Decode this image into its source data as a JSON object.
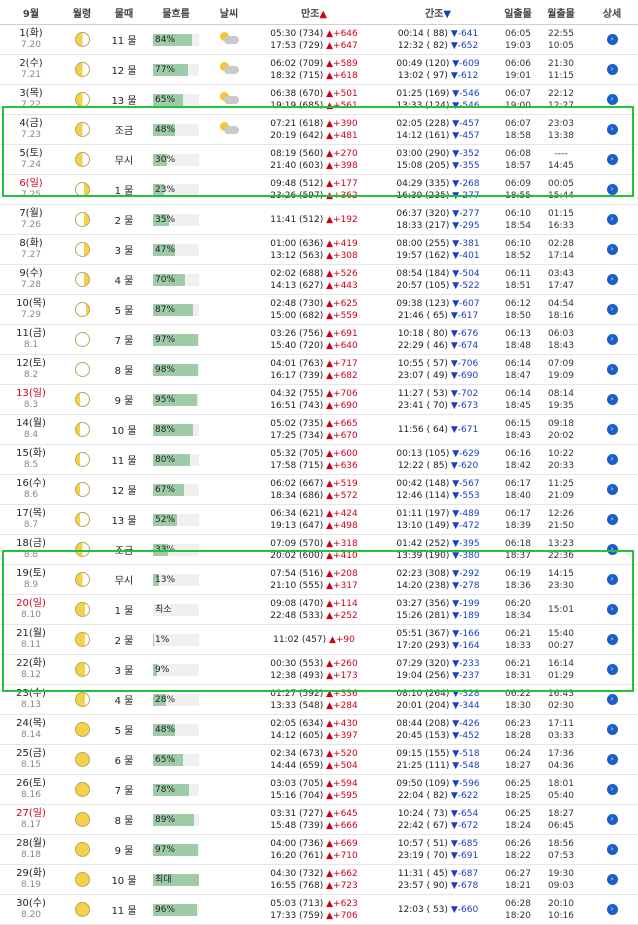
{
  "header": {
    "month": "9월",
    "phase": "월령",
    "mul": "물때",
    "flow": "물흐름",
    "weather": "날씨",
    "high": "만조",
    "low": "간조",
    "sunrise": "일출몰",
    "moonrise": "월출몰",
    "detail": "상세",
    "high_arrow": "▲",
    "low_arrow": "▼"
  },
  "colors": {
    "highlight_border": "#23c23a",
    "bar_fill": "#9fcca8",
    "high_red": "#d0021b",
    "low_blue": "#1a3fbf",
    "detail_blue": "#1a5fc8"
  },
  "rows": [
    {
      "day": "1(화)",
      "lunar": "7.20",
      "phase": "half",
      "mul": "11 물",
      "flow": "84%",
      "flowv": 84,
      "weather": "partly-cloudy-icon",
      "h1": "05:30 (734)",
      "h1d": "▲+646",
      "h2": "17:53 (729)",
      "h2d": "▲+647",
      "l1": "00:14 ( 88)",
      "l1d": "▼-641",
      "l2": "12:32 ( 82)",
      "l2d": "▼-652",
      "sr": "06:05",
      "ss": "19:03",
      "mr": "22:55",
      "ms": "10:05",
      "det": "›"
    },
    {
      "day": "2(수)",
      "lunar": "7.21",
      "phase": "half",
      "mul": "12 물",
      "flow": "77%",
      "flowv": 77,
      "weather": "partly-cloudy-icon",
      "h1": "06:02 (709)",
      "h1d": "▲+589",
      "h2": "18:32 (715)",
      "h2d": "▲+618",
      "l1": "00:49 (120)",
      "l1d": "▼-609",
      "l2": "13:02 ( 97)",
      "l2d": "▼-612",
      "sr": "06:06",
      "ss": "19:01",
      "mr": "21:30",
      "ms": "11:15",
      "det": "›"
    },
    {
      "day": "3(목)",
      "lunar": "7.22",
      "phase": "half",
      "mul": "13 물",
      "flow": "65%",
      "flowv": 65,
      "weather": "partly-cloudy-icon",
      "h1": "06:38 (670)",
      "h1d": "▲+501",
      "h2": "19:19 (685)",
      "h2d": "▲+561",
      "l1": "01:25 (169)",
      "l1d": "▼-546",
      "l2": "13:33 (124)",
      "l2d": "▼-546",
      "sr": "06:07",
      "ss": "19:00",
      "mr": "22:12",
      "ms": "12:27",
      "det": "›"
    },
    {
      "day": "4(금)",
      "lunar": "7.23",
      "phase": "half",
      "mul": "조금",
      "flow": "48%",
      "flowv": 48,
      "weather": "partly-cloudy-icon",
      "h1": "07:21 (618)",
      "h1d": "▲+390",
      "h2": "20:19 (642)",
      "h2d": "▲+481",
      "l1": "02:05 (228)",
      "l1d": "▼-457",
      "l2": "14:12 (161)",
      "l2d": "▼-457",
      "sr": "06:07",
      "ss": "18:58",
      "mr": "23:03",
      "ms": "13:38",
      "det": "›"
    },
    {
      "day": "5(토)",
      "lunar": "7.24",
      "phase": "half",
      "mul": "무시",
      "flow": "30%",
      "flowv": 30,
      "weather": "",
      "h1": "08:19 (560)",
      "h1d": "▲+270",
      "h2": "21:40 (603)",
      "h2d": "▲+398",
      "l1": "03:00 (290)",
      "l1d": "▼-352",
      "l2": "15:08 (205)",
      "l2d": "▼-355",
      "sr": "06:08",
      "ss": "18:57",
      "mr": "----",
      "ms": "14:45",
      "det": "›"
    },
    {
      "day": "6(일)",
      "lunar": "7.25",
      "phase": "crescent",
      "mul": "1 물",
      "flow": "23%",
      "flowv": 23,
      "weather": "",
      "h1": "09:48 (512)",
      "h1d": "▲+177",
      "h2": "23:26 (597)",
      "h2d": "▲+362",
      "l1": "04:29 (335)",
      "l1d": "▼-268",
      "l2": "16:39 (235)",
      "l2d": "▼-277",
      "sr": "06:09",
      "ss": "18:55",
      "mr": "00:05",
      "ms": "15:44",
      "det": "›"
    },
    {
      "day": "7(월)",
      "lunar": "7.26",
      "phase": "crescent",
      "mul": "2 물",
      "flow": "35%",
      "flowv": 35,
      "weather": "",
      "h1": "11:41 (512)",
      "h1d": "▲+192",
      "h2": "",
      "h2d": "",
      "l1": "06:37 (320)",
      "l1d": "▼-277",
      "l2": "18:33 (217)",
      "l2d": "▼-295",
      "sr": "06:10",
      "ss": "18:54",
      "mr": "01:15",
      "ms": "16:33",
      "det": "›"
    },
    {
      "day": "8(화)",
      "lunar": "7.27",
      "phase": "crescent",
      "mul": "3 물",
      "flow": "47%",
      "flowv": 47,
      "weather": "",
      "h1": "01:00 (636)",
      "h1d": "▲+419",
      "h2": "13:12 (563)",
      "h2d": "▲+308",
      "l1": "08:00 (255)",
      "l1d": "▼-381",
      "l2": "19:57 (162)",
      "l2d": "▼-401",
      "sr": "06:10",
      "ss": "18:52",
      "mr": "02:28",
      "ms": "17:14",
      "det": "›"
    },
    {
      "day": "9(수)",
      "lunar": "7.28",
      "phase": "crescent",
      "mul": "4 물",
      "flow": "70%",
      "flowv": 70,
      "weather": "",
      "h1": "02:02 (688)",
      "h1d": "▲+526",
      "h2": "14:13 (627)",
      "h2d": "▲+443",
      "l1": "08:54 (184)",
      "l1d": "▼-504",
      "l2": "20:57 (105)",
      "l2d": "▼-522",
      "sr": "06:11",
      "ss": "18:51",
      "mr": "03:43",
      "ms": "17:47",
      "det": "›"
    },
    {
      "day": "10(목)",
      "lunar": "7.29",
      "phase": "thin",
      "mul": "5 물",
      "flow": "87%",
      "flowv": 87,
      "weather": "",
      "h1": "02:48 (730)",
      "h1d": "▲+625",
      "h2": "15:00 (682)",
      "h2d": "▲+559",
      "l1": "09:38 (123)",
      "l1d": "▼-607",
      "l2": "21:46 ( 65)",
      "l2d": "▼-617",
      "sr": "06:12",
      "ss": "18:50",
      "mr": "04:54",
      "ms": "18:16",
      "det": "›"
    },
    {
      "day": "11(금)",
      "lunar": "8.1",
      "phase": "new",
      "mul": "7 물",
      "flow": "97%",
      "flowv": 97,
      "weather": "",
      "h1": "03:26 (756)",
      "h1d": "▲+691",
      "h2": "15:40 (720)",
      "h2d": "▲+640",
      "l1": "10:18 ( 80)",
      "l1d": "▼-676",
      "l2": "22:29 ( 46)",
      "l2d": "▼-674",
      "sr": "06:13",
      "ss": "18:48",
      "mr": "06:03",
      "ms": "18:43",
      "det": "›"
    },
    {
      "day": "12(토)",
      "lunar": "8.2",
      "phase": "new",
      "mul": "8 물",
      "flow": "98%",
      "flowv": 98,
      "weather": "",
      "h1": "04:01 (763)",
      "h1d": "▲+717",
      "h2": "16:17 (739)",
      "h2d": "▲+682",
      "l1": "10:55 ( 57)",
      "l1d": "▼-706",
      "l2": "23:07 ( 49)",
      "l2d": "▼-690",
      "sr": "06:14",
      "ss": "18:47",
      "mr": "07:09",
      "ms": "19:09",
      "det": "›"
    },
    {
      "day": "13(일)",
      "lunar": "8.3",
      "phase": "waxing",
      "mul": "9 물",
      "flow": "95%",
      "flowv": 95,
      "weather": "",
      "h1": "04:32 (755)",
      "h1d": "▲+706",
      "h2": "16:51 (743)",
      "h2d": "▲+690",
      "l1": "11:27 ( 53)",
      "l1d": "▼-702",
      "l2": "23:41 ( 70)",
      "l2d": "▼-673",
      "sr": "06:14",
      "ss": "18:45",
      "mr": "08:14",
      "ms": "19:35",
      "det": "›"
    },
    {
      "day": "14(월)",
      "lunar": "8.4",
      "phase": "waxing",
      "mul": "10 물",
      "flow": "88%",
      "flowv": 88,
      "weather": "",
      "h1": "05:02 (735)",
      "h1d": "▲+665",
      "h2": "17:25 (734)",
      "h2d": "▲+670",
      "l1": "11:56 ( 64)",
      "l1d": "▼-671",
      "l2": "",
      "l2d": "",
      "sr": "06:15",
      "ss": "18:43",
      "mr": "09:18",
      "ms": "20:02",
      "det": "›"
    },
    {
      "day": "15(화)",
      "lunar": "8.5",
      "phase": "waxing",
      "mul": "11 물",
      "flow": "80%",
      "flowv": 80,
      "weather": "",
      "h1": "05:32 (705)",
      "h1d": "▲+600",
      "h2": "17:58 (715)",
      "h2d": "▲+636",
      "l1": "00:13 (105)",
      "l1d": "▼-629",
      "l2": "12:22 ( 85)",
      "l2d": "▼-620",
      "sr": "06:16",
      "ss": "18:42",
      "mr": "10:22",
      "ms": "20:33",
      "det": "›"
    },
    {
      "day": "16(수)",
      "lunar": "8.6",
      "phase": "waxing",
      "mul": "12 물",
      "flow": "67%",
      "flowv": 67,
      "weather": "",
      "h1": "06:02 (667)",
      "h1d": "▲+519",
      "h2": "18:34 (686)",
      "h2d": "▲+572",
      "l1": "00:42 (148)",
      "l1d": "▼-567",
      "l2": "12:46 (114)",
      "l2d": "▼-553",
      "sr": "06:17",
      "ss": "18:40",
      "mr": "11:25",
      "ms": "21:09",
      "det": "›"
    },
    {
      "day": "17(목)",
      "lunar": "8.7",
      "phase": "waxing",
      "mul": "13 물",
      "flow": "52%",
      "flowv": 52,
      "weather": "",
      "h1": "06:34 (621)",
      "h1d": "▲+424",
      "h2": "19:13 (647)",
      "h2d": "▲+498",
      "l1": "01:11 (197)",
      "l1d": "▼-489",
      "l2": "13:10 (149)",
      "l2d": "▼-472",
      "sr": "06:17",
      "ss": "18:39",
      "mr": "12:26",
      "ms": "21:50",
      "det": "›"
    },
    {
      "day": "18(금)",
      "lunar": "8.8",
      "phase": "half",
      "mul": "조금",
      "flow": "33%",
      "flowv": 33,
      "weather": "",
      "h1": "07:09 (570)",
      "h1d": "▲+318",
      "h2": "20:02 (600)",
      "h2d": "▲+410",
      "l1": "01:42 (252)",
      "l1d": "▼-395",
      "l2": "13:39 (190)",
      "l2d": "▼-380",
      "sr": "06:18",
      "ss": "18:37",
      "mr": "13:23",
      "ms": "22:36",
      "det": "›"
    },
    {
      "day": "19(토)",
      "lunar": "8.9",
      "phase": "half",
      "mul": "무시",
      "flow": "13%",
      "flowv": 13,
      "weather": "",
      "h1": "07:54 (516)",
      "h1d": "▲+208",
      "h2": "21:10 (555)",
      "h2d": "▲+317",
      "l1": "02:23 (308)",
      "l1d": "▼-292",
      "l2": "14:20 (238)",
      "l2d": "▼-278",
      "sr": "06:19",
      "ss": "18:36",
      "mr": "14:15",
      "ms": "23:30",
      "det": "›"
    },
    {
      "day": "20(일)",
      "lunar": "8.10",
      "phase": "gibbous",
      "mul": "1 물",
      "flow": "최소",
      "flowv": 0,
      "weather": "",
      "h1": "09:08 (470)",
      "h1d": "▲+114",
      "h2": "22:48 (533)",
      "h2d": "▲+252",
      "l1": "03:27 (356)",
      "l1d": "▼-199",
      "l2": "15:26 (281)",
      "l2d": "▼-189",
      "sr": "06:20",
      "ss": "18:34",
      "mr": "15:01",
      "ms": "",
      "det": "›"
    },
    {
      "day": "21(월)",
      "lunar": "8.11",
      "phase": "gibbous",
      "mul": "2 물",
      "flow": "1%",
      "flowv": 1,
      "weather": "",
      "h1": "11:02 (457)",
      "h1d": "▲+90",
      "h2": "",
      "h2d": "",
      "l1": "05:51 (367)",
      "l1d": "▼-166",
      "l2": "17:20 (293)",
      "l2d": "▼-164",
      "sr": "06:21",
      "ss": "18:33",
      "mr": "15:40",
      "ms": "00:27",
      "det": "›"
    },
    {
      "day": "22(화)",
      "lunar": "8.12",
      "phase": "gibbous",
      "mul": "3 물",
      "flow": "9%",
      "flowv": 9,
      "weather": "",
      "h1": "00:30 (553)",
      "h1d": "▲+260",
      "h2": "12:38 (493)",
      "h2d": "▲+173",
      "l1": "07:29 (320)",
      "l1d": "▼-233",
      "l2": "19:04 (256)",
      "l2d": "▼-237",
      "sr": "06:21",
      "ss": "18:31",
      "mr": "16:14",
      "ms": "01:29",
      "det": "›"
    },
    {
      "day": "23(수)",
      "lunar": "8.13",
      "phase": "gibbous",
      "mul": "4 물",
      "flow": "28%",
      "flowv": 28,
      "weather": "",
      "h1": "01:27 (592)",
      "h1d": "▲+336",
      "h2": "13:33 (548)",
      "h2d": "▲+284",
      "l1": "08:10 (264)",
      "l1d": "▼-328",
      "l2": "20:01 (204)",
      "l2d": "▼-344",
      "sr": "06:22",
      "ss": "18:30",
      "mr": "16:43",
      "ms": "02:30",
      "det": "›"
    },
    {
      "day": "24(목)",
      "lunar": "8.14",
      "phase": "full",
      "mul": "5 물",
      "flow": "48%",
      "flowv": 48,
      "weather": "",
      "h1": "02:05 (634)",
      "h1d": "▲+430",
      "h2": "14:12 (605)",
      "h2d": "▲+397",
      "l1": "08:44 (208)",
      "l1d": "▼-426",
      "l2": "20:45 (153)",
      "l2d": "▼-452",
      "sr": "06:23",
      "ss": "18:28",
      "mr": "17:11",
      "ms": "03:33",
      "det": "›"
    },
    {
      "day": "25(금)",
      "lunar": "8.15",
      "phase": "full",
      "mul": "6 물",
      "flow": "65%",
      "flowv": 65,
      "weather": "",
      "h1": "02:34 (673)",
      "h1d": "▲+520",
      "h2": "14:44 (659)",
      "h2d": "▲+504",
      "l1": "09:15 (155)",
      "l1d": "▼-518",
      "l2": "21:25 (111)",
      "l2d": "▼-548",
      "sr": "06:24",
      "ss": "18:27",
      "mr": "17:36",
      "ms": "04:36",
      "det": "›"
    },
    {
      "day": "26(토)",
      "lunar": "8.16",
      "phase": "full",
      "mul": "7 물",
      "flow": "78%",
      "flowv": 78,
      "weather": "",
      "h1": "03:03 (705)",
      "h1d": "▲+594",
      "h2": "15:16 (704)",
      "h2d": "▲+595",
      "l1": "09:50 (109)",
      "l1d": "▼-596",
      "l2": "22:04 ( 82)",
      "l2d": "▼-622",
      "sr": "06:25",
      "ss": "18:25",
      "mr": "18:01",
      "ms": "05:40",
      "det": "›"
    },
    {
      "day": "27(일)",
      "lunar": "8.17",
      "phase": "full",
      "mul": "8 물",
      "flow": "89%",
      "flowv": 89,
      "weather": "",
      "h1": "03:31 (727)",
      "h1d": "▲+645",
      "h2": "15:48 (739)",
      "h2d": "▲+666",
      "l1": "10:24 ( 73)",
      "l1d": "▼-654",
      "l2": "22:42 ( 67)",
      "l2d": "▼-672",
      "sr": "06:25",
      "ss": "18:24",
      "mr": "18:27",
      "ms": "06:45",
      "det": "›"
    },
    {
      "day": "28(월)",
      "lunar": "8.18",
      "phase": "full",
      "mul": "9 물",
      "flow": "97%",
      "flowv": 97,
      "weather": "",
      "h1": "04:00 (736)",
      "h1d": "▲+669",
      "h2": "16:20 (761)",
      "h2d": "▲+710",
      "l1": "10:57 ( 51)",
      "l1d": "▼-685",
      "l2": "23:19 ( 70)",
      "l2d": "▼-691",
      "sr": "06:26",
      "ss": "18:22",
      "mr": "18:56",
      "ms": "07:53",
      "det": "›"
    },
    {
      "day": "29(화)",
      "lunar": "8.19",
      "phase": "full",
      "mul": "10 물",
      "flow": "최대",
      "flowv": 100,
      "weather": "",
      "h1": "04:30 (732)",
      "h1d": "▲+662",
      "h2": "16:55 (768)",
      "h2d": "▲+723",
      "l1": "11:31 ( 45)",
      "l1d": "▼-687",
      "l2": "23:57 ( 90)",
      "l2d": "▼-678",
      "sr": "06:27",
      "ss": "18:21",
      "mr": "19:30",
      "ms": "09:03",
      "det": "›"
    },
    {
      "day": "30(수)",
      "lunar": "8.20",
      "phase": "full",
      "mul": "11 물",
      "flow": "96%",
      "flowv": 96,
      "weather": "",
      "h1": "05:03 (713)",
      "h1d": "▲+623",
      "h2": "17:33 (759)",
      "h2d": "▲+706",
      "l1": "12:03 ( 53)",
      "l1d": "▼-660",
      "l2": "",
      "l2d": "",
      "sr": "06:28",
      "ss": "18:20",
      "mr": "20:10",
      "ms": "10:16",
      "det": "›"
    }
  ]
}
